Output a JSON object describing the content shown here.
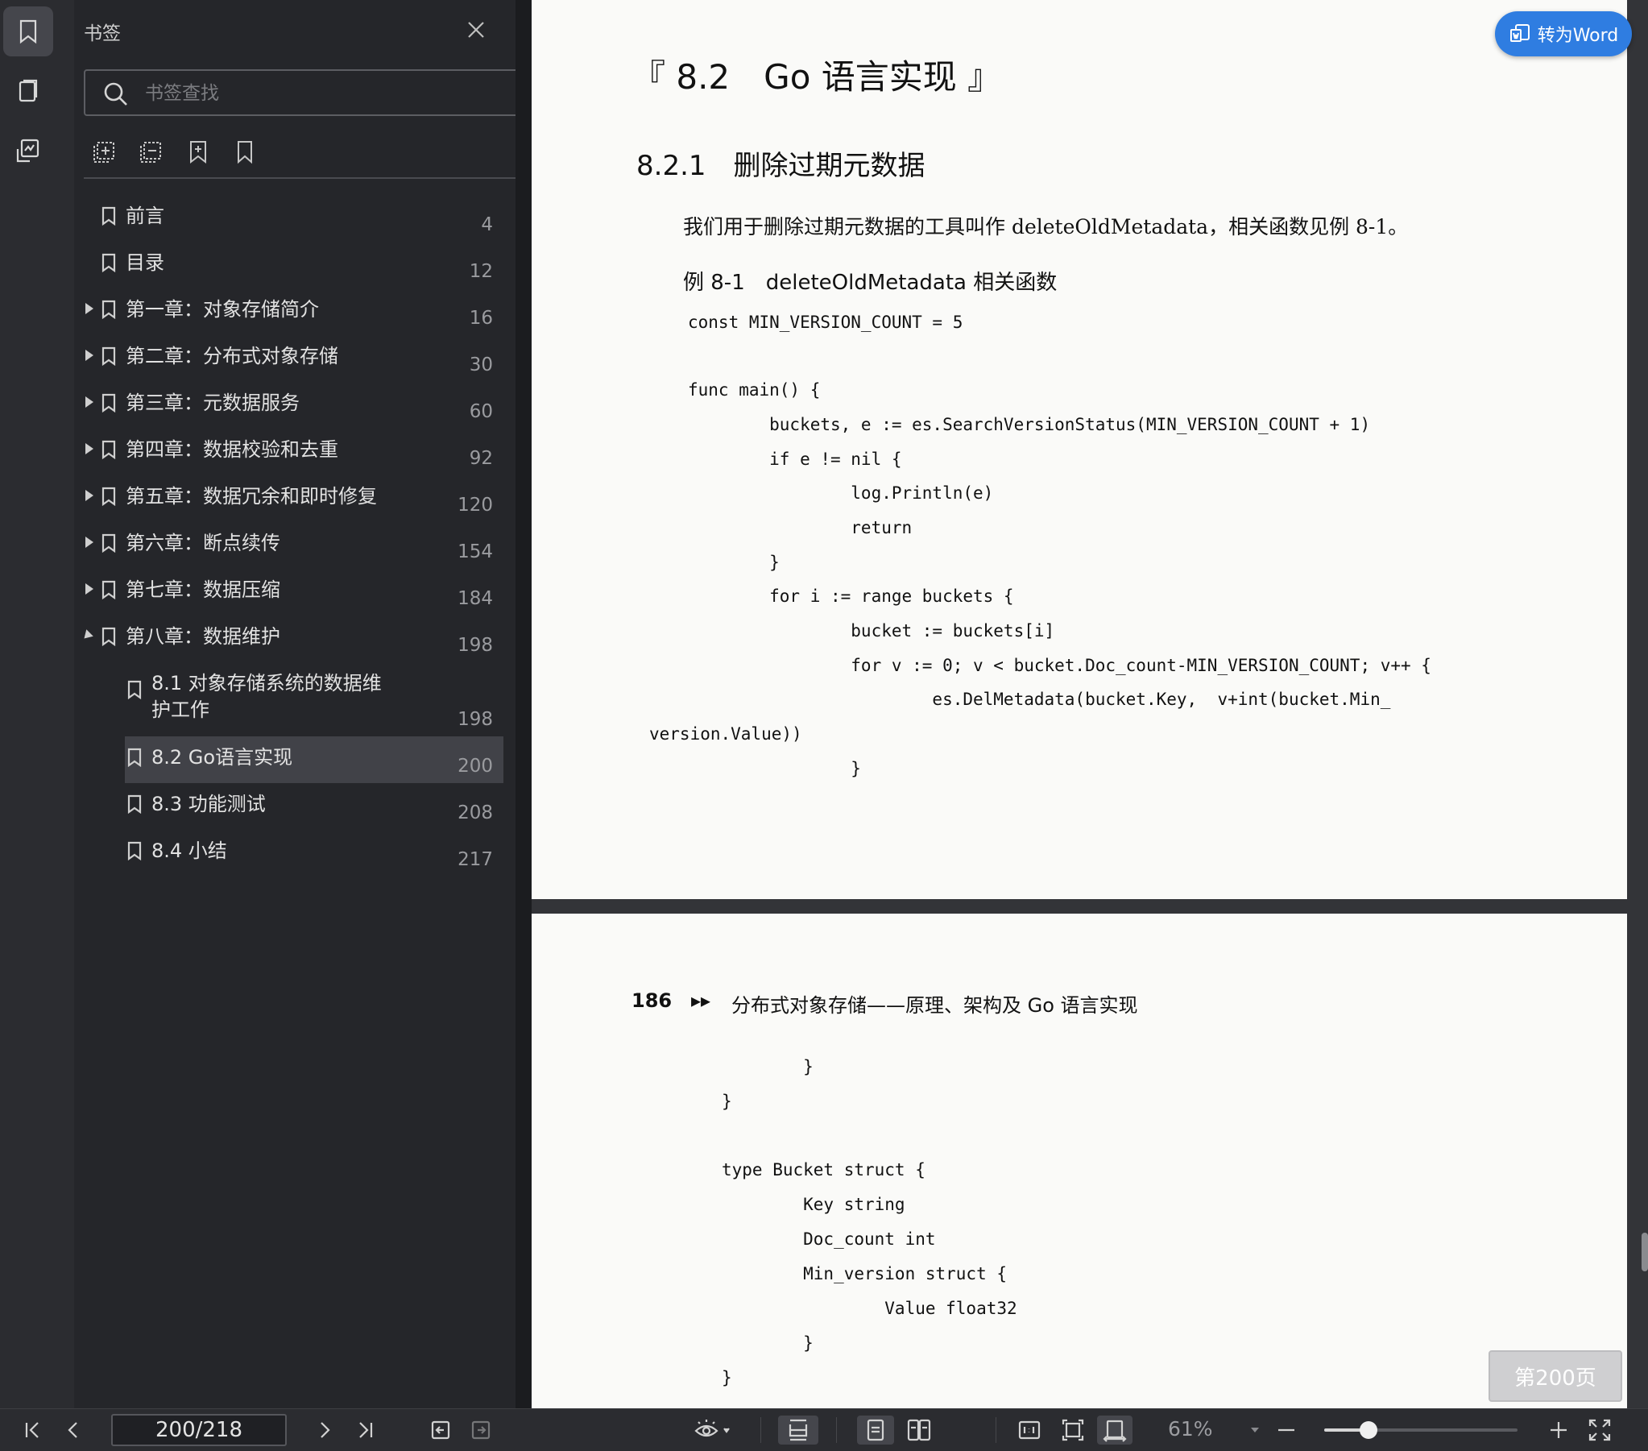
{
  "sidebar_rail": {
    "items": [
      {
        "name": "bookmark-rail-icon"
      },
      {
        "name": "pages-rail-icon"
      },
      {
        "name": "annotation-rail-icon"
      }
    ]
  },
  "bookmarks_panel": {
    "title": "书签",
    "search_placeholder": "书签查找",
    "items": [
      {
        "label": "前言",
        "page": "4",
        "expand": "none",
        "level": 0
      },
      {
        "label": "目录",
        "page": "12",
        "expand": "none",
        "level": 0
      },
      {
        "label": "第一章：对象存储简介",
        "page": "16",
        "expand": "collapsed",
        "level": 0
      },
      {
        "label": "第二章：分布式对象存储",
        "page": "30",
        "expand": "collapsed",
        "level": 0
      },
      {
        "label": "第三章：元数据服务",
        "page": "60",
        "expand": "collapsed",
        "level": 0
      },
      {
        "label": "第四章：数据校验和去重",
        "page": "92",
        "expand": "collapsed",
        "level": 0
      },
      {
        "label": "第五章：数据冗余和即时修复",
        "page": "120",
        "expand": "collapsed",
        "level": 0
      },
      {
        "label": "第六章：断点续传",
        "page": "154",
        "expand": "collapsed",
        "level": 0
      },
      {
        "label": "第七章：数据压缩",
        "page": "184",
        "expand": "collapsed",
        "level": 0
      },
      {
        "label": "第八章：数据维护",
        "page": "198",
        "expand": "expanded",
        "level": 0
      },
      {
        "label": "8.1 对象存储系统的数据维",
        "label2": "护工作",
        "page": "198",
        "expand": "none",
        "level": 1
      },
      {
        "label": "8.2 Go语言实现",
        "page": "200",
        "expand": "none",
        "level": 1,
        "selected": true
      },
      {
        "label": "8.3 功能测试",
        "page": "208",
        "expand": "none",
        "level": 1
      },
      {
        "label": "8.4 小结",
        "page": "217",
        "expand": "none",
        "level": 1
      }
    ]
  },
  "document": {
    "page1": {
      "section_title": "『 8.2　Go 语言实现 』",
      "subsection_title": "8.2.1　删除过期元数据",
      "paragraph": "我们用于删除过期元数据的工具叫作 deleteOldMetadata，相关函数见例 8-1。",
      "example_caption": "例 8-1　deleteOldMetadata 相关函数",
      "code_lines": [
        "const MIN_VERSION_COUNT = 5",
        "",
        "func main() {",
        "        buckets, e := es.SearchVersionStatus(MIN_VERSION_COUNT + 1)",
        "        if e != nil {",
        "                log.Println(e)",
        "                return",
        "        }",
        "        for i := range buckets {",
        "                bucket := buckets[i]",
        "                for v := 0; v < bucket.Doc_count-MIN_VERSION_COUNT; v++ {",
        "                        es.DelMetadata(bucket.Key,  v+int(bucket.Min_",
        "version.Value))",
        "                }"
      ]
    },
    "page2": {
      "page_number": "186",
      "running_header": "分布式对象存储——原理、架构及 Go 语言实现",
      "header_arrows": "▸▸",
      "code_lines": [
        "        }",
        "}",
        "",
        "type Bucket struct {",
        "        Key string",
        "        Doc_count int",
        "        Min_version struct {",
        "                Value float32",
        "        }",
        "}"
      ]
    },
    "convert_button_label": "转为Word",
    "page_badge": "第200页"
  },
  "bottom_toolbar": {
    "page_indicator": "200/218",
    "zoom_level": "61%",
    "zoom_slider_fraction": 0.23
  },
  "colors": {
    "accent": "#2f7de1",
    "panel_bg": "#25262a",
    "selected_row": "#414248"
  }
}
